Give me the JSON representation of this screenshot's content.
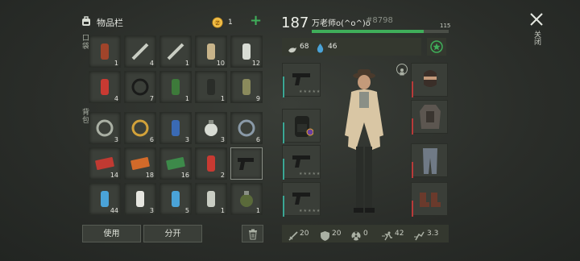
{
  "header": {
    "title": "物品栏",
    "coin_count": "1",
    "add_symbol": "+"
  },
  "sections": {
    "pockets_label": "口袋",
    "backpack_label": "背包"
  },
  "inventory": [
    {
      "name": "medicine-bottle",
      "count": "1"
    },
    {
      "name": "flashlight",
      "count": "4"
    },
    {
      "name": "wrench",
      "count": "1"
    },
    {
      "name": "rope-spool",
      "count": "10"
    },
    {
      "name": "spray-can",
      "count": "12"
    },
    {
      "name": "cigarette-pack",
      "count": "4"
    },
    {
      "name": "rubber-rings",
      "count": "7"
    },
    {
      "name": "circuit-board",
      "count": "1"
    },
    {
      "name": "paint-can",
      "count": "1"
    },
    {
      "name": "cloth-scrap",
      "count": "9"
    },
    {
      "name": "bearing-ring",
      "count": "3"
    },
    {
      "name": "gold-ring",
      "count": "6"
    },
    {
      "name": "batteries",
      "count": "3"
    },
    {
      "name": "light-bulb",
      "count": "3"
    },
    {
      "name": "cable-coil",
      "count": "6"
    },
    {
      "name": "red-coupon",
      "count": "14"
    },
    {
      "name": "orange-coupon",
      "count": "18"
    },
    {
      "name": "green-coupon",
      "count": "16"
    },
    {
      "name": "red-spray-can",
      "count": "2"
    },
    {
      "name": "pistol",
      "count": ""
    },
    {
      "name": "water-bottle",
      "count": "44"
    },
    {
      "name": "bandage-pack",
      "count": "3"
    },
    {
      "name": "blue-bottle",
      "count": "5"
    },
    {
      "name": "aerosol-can",
      "count": "1"
    },
    {
      "name": "grenade",
      "count": "1"
    }
  ],
  "actions": {
    "use_label": "使用",
    "split_label": "分开"
  },
  "player": {
    "level": "187",
    "name": "万老师o(^o^)o",
    "id": "#8798",
    "xp_value": "115",
    "xp_fraction": 0.82,
    "food": "68",
    "water": "46"
  },
  "close_label": "关闭",
  "stats": {
    "attack": "20",
    "defense": "20",
    "radiation": "0",
    "speed": "42",
    "stealth": "3.3"
  },
  "colors": {
    "xp_bar": "#3fae5a",
    "accent_teal": "#3aa694",
    "durability_red": "#b83a3a",
    "add_green": "#3fae5a"
  }
}
